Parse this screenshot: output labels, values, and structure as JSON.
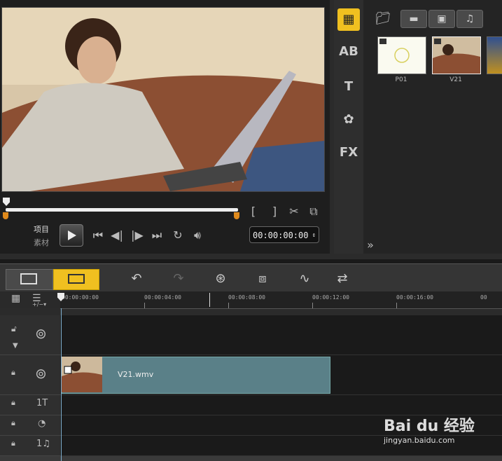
{
  "preview": {
    "project_label": "项目",
    "clip_label": "素材",
    "timecode": "00:00:00:00",
    "controls": [
      "to-start-icon",
      "prev-frame-icon",
      "next-frame-icon",
      "to-end-icon",
      "repeat-icon",
      "volume-icon"
    ],
    "scrub_position": 0.0
  },
  "library": {
    "tabs": [
      "video-filter-tab",
      "image-filter-tab",
      "audio-filter-tab"
    ],
    "side_items": [
      "media-icon",
      "transition-icon",
      "title-icon",
      "graphic-icon",
      "fx-icon"
    ],
    "side_labels": {
      "transition": "AB",
      "title": "T",
      "fx": "FX"
    },
    "thumbs": [
      {
        "label": "P01"
      },
      {
        "label": "V21"
      },
      {
        "label": ""
      }
    ],
    "expand_glyph": "»"
  },
  "timeline": {
    "tick_labels": [
      "00:00:00:00",
      "00:00:04:00",
      "00:00:08:00",
      "00:00:12:00",
      "00:00:16:00",
      "00"
    ],
    "clip": {
      "label": "V21.wmv"
    },
    "track_labels": {
      "title": "1T",
      "voice": "",
      "music": "1♫"
    },
    "zoom_glyph": "+/−▾"
  },
  "watermark": {
    "brand": "Bai du 经验",
    "url": "jingyan.baidu.com"
  },
  "colors": {
    "accent": "#f0c020",
    "clip": "#5a8088",
    "marker": "#e08a1c"
  }
}
